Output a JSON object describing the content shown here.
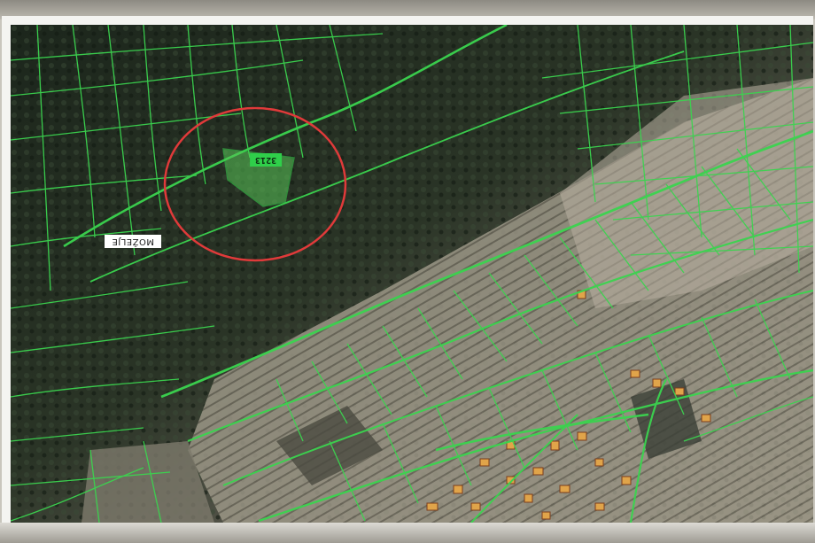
{
  "map": {
    "place_label": "MOŽELJE",
    "parcel_number": "3213",
    "colors": {
      "parcel_boundary": "#3bd44f",
      "highlight_circle": "#e03a3a",
      "highlight_parcel": "#58c457",
      "forest": "#1f2a1e",
      "fields": "#8e8a7c",
      "building": "#e0a44a",
      "paper": "#f4f4f1"
    },
    "icons": [
      "parcel-boundary-lines",
      "highlight-circle",
      "building-markers"
    ]
  }
}
